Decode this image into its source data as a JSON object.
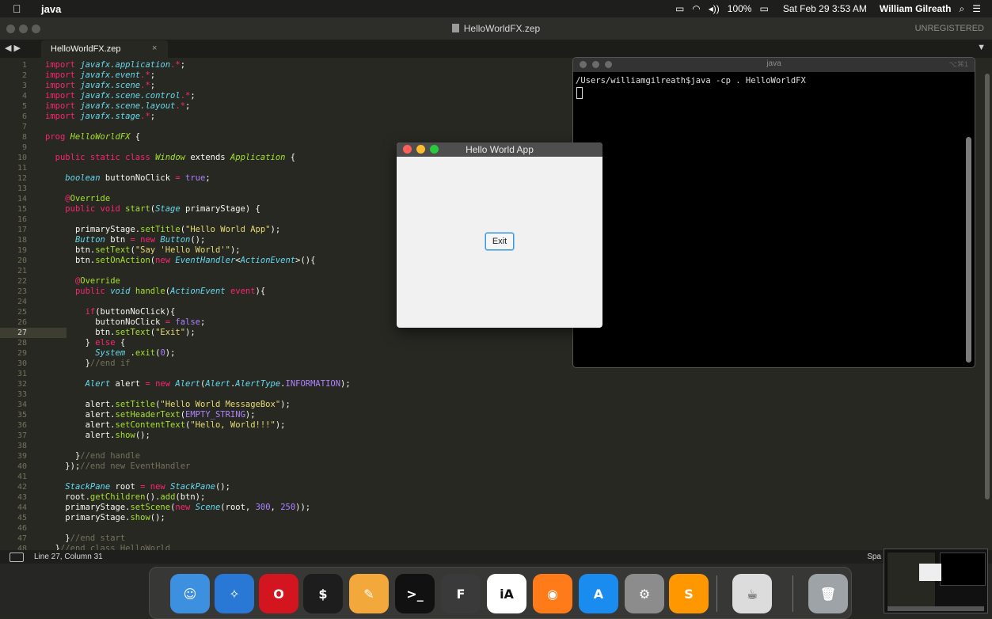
{
  "menubar": {
    "app_name": "java",
    "battery": "100%",
    "datetime": "Sat Feb 29  3:53 AM",
    "user": "William Gilreath"
  },
  "window": {
    "title": "HelloWorldFX.zep",
    "license": "UNREGISTERED"
  },
  "tab": {
    "label": "HelloWorldFX.zep",
    "close": "×"
  },
  "editor": {
    "line_numbers": [
      "1",
      "2",
      "3",
      "4",
      "5",
      "6",
      "7",
      "8",
      "9",
      "10",
      "11",
      "12",
      "13",
      "14",
      "15",
      "16",
      "17",
      "18",
      "19",
      "20",
      "21",
      "22",
      "23",
      "24",
      "25",
      "26",
      "27",
      "28",
      "29",
      "30",
      "31",
      "32",
      "33",
      "34",
      "35",
      "36",
      "37",
      "38",
      "39",
      "40",
      "41",
      "42",
      "43",
      "44",
      "45",
      "46",
      "47",
      "48"
    ],
    "active_line": "27",
    "lines": [
      {
        "indent": "",
        "tokens": [
          [
            "kw",
            "import "
          ],
          [
            "it",
            "javafx.application"
          ],
          [
            "kw",
            ".*"
          ],
          [
            "",
            "; "
          ]
        ]
      },
      {
        "indent": "",
        "tokens": [
          [
            "kw",
            "import "
          ],
          [
            "it",
            "javafx.event"
          ],
          [
            "kw",
            ".*"
          ],
          [
            "",
            ";"
          ]
        ]
      },
      {
        "indent": "",
        "tokens": [
          [
            "kw",
            "import "
          ],
          [
            "it",
            "javafx.scene"
          ],
          [
            "kw",
            ".*"
          ],
          [
            "",
            ";"
          ]
        ]
      },
      {
        "indent": "",
        "tokens": [
          [
            "kw",
            "import "
          ],
          [
            "it",
            "javafx.scene.control"
          ],
          [
            "kw",
            ".*"
          ],
          [
            "",
            ";"
          ]
        ]
      },
      {
        "indent": "",
        "tokens": [
          [
            "kw",
            "import "
          ],
          [
            "it",
            "javafx.scene.layout"
          ],
          [
            "kw",
            ".*"
          ],
          [
            "",
            ";"
          ]
        ]
      },
      {
        "indent": "",
        "tokens": [
          [
            "kw",
            "import "
          ],
          [
            "it",
            "javafx.stage"
          ],
          [
            "kw",
            ".*"
          ],
          [
            "",
            ";"
          ]
        ]
      },
      {
        "indent": "",
        "tokens": []
      },
      {
        "indent": "",
        "tokens": [
          [
            "kw",
            "prog "
          ],
          [
            "cl",
            "HelloWorldFX"
          ],
          [
            "",
            " {"
          ]
        ]
      },
      {
        "indent": "",
        "tokens": []
      },
      {
        "indent": "  ",
        "tokens": [
          [
            "kw",
            "public static class "
          ],
          [
            "cl",
            "Window"
          ],
          [
            "",
            " extends "
          ],
          [
            "cl",
            "Application"
          ],
          [
            "",
            " {"
          ]
        ]
      },
      {
        "indent": "",
        "tokens": []
      },
      {
        "indent": "    ",
        "tokens": [
          [
            "it",
            "boolean"
          ],
          [
            "",
            " buttonNoClick "
          ],
          [
            "kw",
            "="
          ],
          [
            "pu",
            " true"
          ],
          [
            "",
            ";"
          ]
        ]
      },
      {
        "indent": "",
        "tokens": []
      },
      {
        "indent": "    ",
        "tokens": [
          [
            "kw",
            "@"
          ],
          [
            "gr",
            "Override"
          ]
        ]
      },
      {
        "indent": "    ",
        "tokens": [
          [
            "kw",
            "public void "
          ],
          [
            "gr",
            "start"
          ],
          [
            "",
            "("
          ],
          [
            "it",
            "Stage"
          ],
          [
            "",
            " primaryStage) {"
          ]
        ]
      },
      {
        "indent": "",
        "tokens": []
      },
      {
        "indent": "      ",
        "tokens": [
          [
            "",
            "primaryStage."
          ],
          [
            "gr",
            "setTitle"
          ],
          [
            "",
            "("
          ],
          [
            "st",
            "\"Hello World App\""
          ],
          [
            "",
            ");"
          ]
        ]
      },
      {
        "indent": "      ",
        "tokens": [
          [
            "it",
            "Button"
          ],
          [
            "",
            " btn "
          ],
          [
            "kw",
            "= new "
          ],
          [
            "it",
            "Button"
          ],
          [
            "",
            "();"
          ]
        ]
      },
      {
        "indent": "      ",
        "tokens": [
          [
            "",
            "btn."
          ],
          [
            "gr",
            "setText"
          ],
          [
            "",
            "("
          ],
          [
            "st",
            "\"Say 'Hello World'\""
          ],
          [
            "",
            ");"
          ]
        ]
      },
      {
        "indent": "      ",
        "tokens": [
          [
            "",
            "btn."
          ],
          [
            "gr",
            "setOnAction"
          ],
          [
            "",
            "("
          ],
          [
            "kw",
            "new "
          ],
          [
            "it",
            "EventHandler"
          ],
          [
            "",
            "<"
          ],
          [
            "it",
            "ActionEvent"
          ],
          [
            "",
            ">(){"
          ]
        ]
      },
      {
        "indent": "",
        "tokens": []
      },
      {
        "indent": "      ",
        "tokens": [
          [
            "kw",
            "@"
          ],
          [
            "gr",
            "Override"
          ]
        ]
      },
      {
        "indent": "      ",
        "tokens": [
          [
            "kw",
            "public "
          ],
          [
            "it",
            "void "
          ],
          [
            "gr",
            "handle"
          ],
          [
            "",
            "("
          ],
          [
            "it",
            "ActionEvent "
          ],
          [
            "kw",
            "event"
          ],
          [
            "",
            "){"
          ]
        ]
      },
      {
        "indent": "",
        "tokens": []
      },
      {
        "indent": "        ",
        "tokens": [
          [
            "kw",
            "if"
          ],
          [
            "",
            "(buttonNoClick){"
          ]
        ]
      },
      {
        "indent": "          ",
        "tokens": [
          [
            "",
            "buttonNoClick "
          ],
          [
            "kw",
            "="
          ],
          [
            "pu",
            " false"
          ],
          [
            "",
            ";"
          ]
        ]
      },
      {
        "indent": "          ",
        "tokens": [
          [
            "",
            "btn."
          ],
          [
            "gr",
            "setText"
          ],
          [
            "",
            "("
          ],
          [
            "st",
            "\"Exit\""
          ],
          [
            "",
            ");"
          ]
        ]
      },
      {
        "indent": "        ",
        "tokens": [
          [
            "",
            "} "
          ],
          [
            "kw",
            "else"
          ],
          [
            "",
            " {"
          ]
        ]
      },
      {
        "indent": "          ",
        "tokens": [
          [
            "it",
            "System"
          ],
          [
            "",
            " ."
          ],
          [
            "gr",
            "exit"
          ],
          [
            "",
            "("
          ],
          [
            "pu",
            "0"
          ],
          [
            "",
            ");"
          ]
        ]
      },
      {
        "indent": "        ",
        "tokens": [
          [
            "",
            "}"
          ],
          [
            "cm",
            "//end if"
          ]
        ]
      },
      {
        "indent": "",
        "tokens": []
      },
      {
        "indent": "        ",
        "tokens": [
          [
            "it",
            "Alert"
          ],
          [
            "",
            " alert "
          ],
          [
            "kw",
            "= new "
          ],
          [
            "it",
            "Alert"
          ],
          [
            "",
            "("
          ],
          [
            "it",
            "Alert"
          ],
          [
            "",
            "."
          ],
          [
            "it",
            "AlertType"
          ],
          [
            "",
            "."
          ],
          [
            "pu",
            "INFORMATION"
          ],
          [
            "",
            ");"
          ]
        ]
      },
      {
        "indent": "",
        "tokens": []
      },
      {
        "indent": "        ",
        "tokens": [
          [
            "",
            "alert."
          ],
          [
            "gr",
            "setTitle"
          ],
          [
            "",
            "("
          ],
          [
            "st",
            "\"Hello World MessageBox\""
          ],
          [
            "",
            ");"
          ]
        ]
      },
      {
        "indent": "        ",
        "tokens": [
          [
            "",
            "alert."
          ],
          [
            "gr",
            "setHeaderText"
          ],
          [
            "",
            "("
          ],
          [
            "pu",
            "EMPTY_STRING"
          ],
          [
            "",
            ");"
          ]
        ]
      },
      {
        "indent": "        ",
        "tokens": [
          [
            "",
            "alert."
          ],
          [
            "gr",
            "setContentText"
          ],
          [
            "",
            "("
          ],
          [
            "st",
            "\"Hello, World!!!\""
          ],
          [
            "",
            ");"
          ]
        ]
      },
      {
        "indent": "        ",
        "tokens": [
          [
            "",
            "alert."
          ],
          [
            "gr",
            "show"
          ],
          [
            "",
            "();"
          ]
        ]
      },
      {
        "indent": "",
        "tokens": []
      },
      {
        "indent": "      ",
        "tokens": [
          [
            "",
            "}"
          ],
          [
            "cm",
            "//end handle"
          ]
        ]
      },
      {
        "indent": "    ",
        "tokens": [
          [
            "",
            "});"
          ],
          [
            "cm",
            "//end new EventHandler"
          ]
        ]
      },
      {
        "indent": "",
        "tokens": []
      },
      {
        "indent": "    ",
        "tokens": [
          [
            "it",
            "StackPane"
          ],
          [
            "",
            " root "
          ],
          [
            "kw",
            "= new "
          ],
          [
            "it",
            "StackPane"
          ],
          [
            "",
            "();"
          ]
        ]
      },
      {
        "indent": "    ",
        "tokens": [
          [
            "",
            "root."
          ],
          [
            "gr",
            "getChildren"
          ],
          [
            "",
            "()."
          ],
          [
            "gr",
            "add"
          ],
          [
            "",
            "(btn);"
          ]
        ]
      },
      {
        "indent": "    ",
        "tokens": [
          [
            "",
            "primaryStage."
          ],
          [
            "gr",
            "setScene"
          ],
          [
            "",
            "("
          ],
          [
            "kw",
            "new "
          ],
          [
            "it",
            "Scene"
          ],
          [
            "",
            "(root, "
          ],
          [
            "pu",
            "300"
          ],
          [
            "",
            ", "
          ],
          [
            "pu",
            "250"
          ],
          [
            "",
            "));"
          ]
        ]
      },
      {
        "indent": "    ",
        "tokens": [
          [
            "",
            "primaryStage."
          ],
          [
            "gr",
            "show"
          ],
          [
            "",
            "();"
          ]
        ]
      },
      {
        "indent": "",
        "tokens": []
      },
      {
        "indent": "  ",
        "tokens": [
          [
            "",
            "  }"
          ],
          [
            "cm",
            "//end start"
          ]
        ]
      },
      {
        "indent": "  ",
        "tokens": [
          [
            "",
            "}"
          ],
          [
            "cm",
            "//end class HelloWorld"
          ]
        ]
      }
    ]
  },
  "statusbar": {
    "position": "Line 27, Column 31",
    "spaces": "Spa"
  },
  "terminal": {
    "title": "java",
    "shortcut": "⌥⌘1",
    "prompt_line": "/Users/williamgilreath$java -cp . HelloWorldFX"
  },
  "fxwindow": {
    "title": "Hello World App",
    "button_label": "Exit"
  },
  "dock": {
    "items": [
      {
        "name": "finder-icon",
        "glyph": "☺",
        "bg": "#3d8fe0"
      },
      {
        "name": "safari-icon",
        "glyph": "✧",
        "bg": "#2a78d6"
      },
      {
        "name": "opera-icon",
        "glyph": "O",
        "bg": "#d2151e"
      },
      {
        "name": "terminal-green-icon",
        "glyph": "$",
        "bg": "#1d1d1d"
      },
      {
        "name": "pages-icon",
        "glyph": "✎",
        "bg": "#f2a83a"
      },
      {
        "name": "terminal-icon",
        "glyph": ">_",
        "bg": "#111111"
      },
      {
        "name": "fontforge-icon",
        "glyph": "F",
        "bg": "#3a3a3a"
      },
      {
        "name": "ia-writer-icon",
        "glyph": "iA",
        "bg": "#ffffff"
      },
      {
        "name": "firefox-icon",
        "glyph": "◉",
        "bg": "#ff7a18"
      },
      {
        "name": "app-store-icon",
        "glyph": "A",
        "bg": "#1a8cf0"
      },
      {
        "name": "system-preferences-icon",
        "glyph": "⚙",
        "bg": "#8c8c8c"
      },
      {
        "name": "sublime-text-icon",
        "glyph": "S",
        "bg": "#ff9800"
      },
      {
        "name": "java-coffee-icon",
        "glyph": "☕",
        "bg": "#dcdcdc"
      },
      {
        "name": "trash-icon",
        "glyph": "🗑",
        "bg": "#9ea3a8"
      }
    ]
  }
}
